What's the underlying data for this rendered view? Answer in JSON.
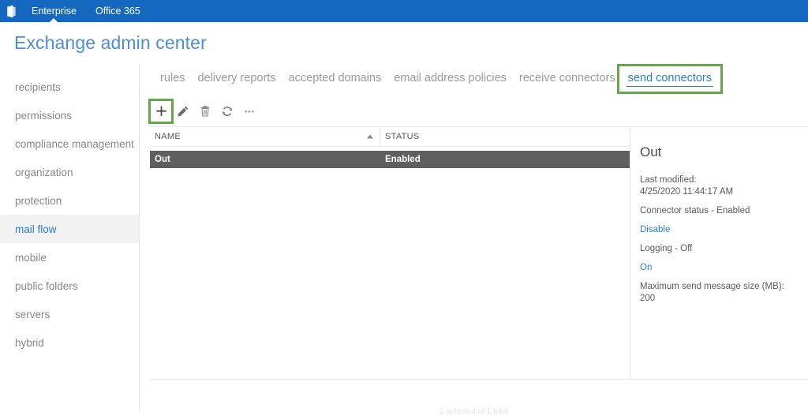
{
  "suite_bar": {
    "app_launcher_icon": "office-waffle-icon",
    "links": [
      {
        "label": "Enterprise",
        "active": true
      },
      {
        "label": "Office 365",
        "active": false
      }
    ]
  },
  "header": {
    "title": "Exchange admin center"
  },
  "sidebar": {
    "items": [
      {
        "label": "recipients",
        "selected": false
      },
      {
        "label": "permissions",
        "selected": false
      },
      {
        "label": "compliance management",
        "selected": false
      },
      {
        "label": "organization",
        "selected": false
      },
      {
        "label": "protection",
        "selected": false
      },
      {
        "label": "mail flow",
        "selected": true
      },
      {
        "label": "mobile",
        "selected": false
      },
      {
        "label": "public folders",
        "selected": false
      },
      {
        "label": "servers",
        "selected": false
      },
      {
        "label": "hybrid",
        "selected": false
      }
    ]
  },
  "tabs": [
    {
      "label": "rules",
      "active": false
    },
    {
      "label": "delivery reports",
      "active": false
    },
    {
      "label": "accepted domains",
      "active": false
    },
    {
      "label": "email address policies",
      "active": false
    },
    {
      "label": "receive connectors",
      "active": false
    },
    {
      "label": "send connectors",
      "active": true,
      "highlighted": true
    }
  ],
  "toolbar": {
    "buttons": [
      {
        "name": "new-button",
        "icon": "plus-icon",
        "highlighted": true
      },
      {
        "name": "edit-button",
        "icon": "pencil-icon",
        "highlighted": false
      },
      {
        "name": "delete-button",
        "icon": "trash-icon",
        "highlighted": false
      },
      {
        "name": "refresh-button",
        "icon": "refresh-icon",
        "highlighted": false
      },
      {
        "name": "more-options-button",
        "icon": "ellipsis-icon",
        "highlighted": false
      }
    ]
  },
  "grid": {
    "columns": [
      {
        "label": "NAME",
        "sort": "ascending"
      },
      {
        "label": "STATUS",
        "sort": "none"
      }
    ],
    "rows": [
      {
        "name": "Out",
        "status": "Enabled",
        "selected": true
      }
    ]
  },
  "details": {
    "title": "Out",
    "last_modified_label": "Last modified:",
    "last_modified_value": "4/25/2020 11:44:17 AM",
    "connector_status": "Connector status - Enabled",
    "disable_link": "Disable",
    "logging": "Logging - Off",
    "logging_link": "On",
    "max_size_label": "Maximum send message size (MB):",
    "max_size_value": "200"
  },
  "footer": {
    "status": "1 selected of 1 total"
  },
  "colors": {
    "suite_bar": "#1568bf",
    "accent_blue": "#2c7fc4",
    "title_blue": "#4f8fd0",
    "annotation_green": "#63a84b",
    "selected_row": "#5f5f5f"
  }
}
